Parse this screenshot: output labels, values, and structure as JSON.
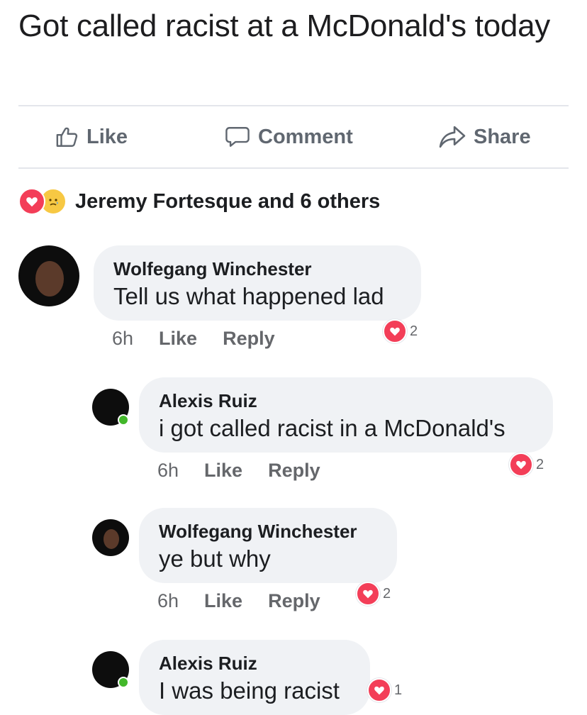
{
  "post": {
    "text": "Got called racist at a McDonald's today"
  },
  "actions": {
    "like": "Like",
    "comment": "Comment",
    "share": "Share"
  },
  "reactions": {
    "summary": "Jeremy Fortesque and 6 others",
    "types": [
      "love",
      "sad"
    ]
  },
  "comments": [
    {
      "author": "Wolfegang Winchester",
      "text": "Tell us what happened lad",
      "time": "6h",
      "like": "Like",
      "reply": "Reply",
      "reaction_count": "2"
    },
    {
      "author": "Alexis Ruiz",
      "text": "i got called racist in a McDonald's",
      "time": "6h",
      "like": "Like",
      "reply": "Reply",
      "reaction_count": "2"
    },
    {
      "author": "Wolfegang Winchester",
      "text": "ye but why",
      "time": "6h",
      "like": "Like",
      "reply": "Reply",
      "reaction_count": "2"
    },
    {
      "author": "Alexis Ruiz",
      "text": "I was being racist",
      "reaction_count": "1"
    }
  ],
  "colors": {
    "love": "#f33e58",
    "sad": "#f7c843",
    "bubble": "#f0f2f5",
    "meta": "#65676b",
    "online": "#42b72a"
  }
}
